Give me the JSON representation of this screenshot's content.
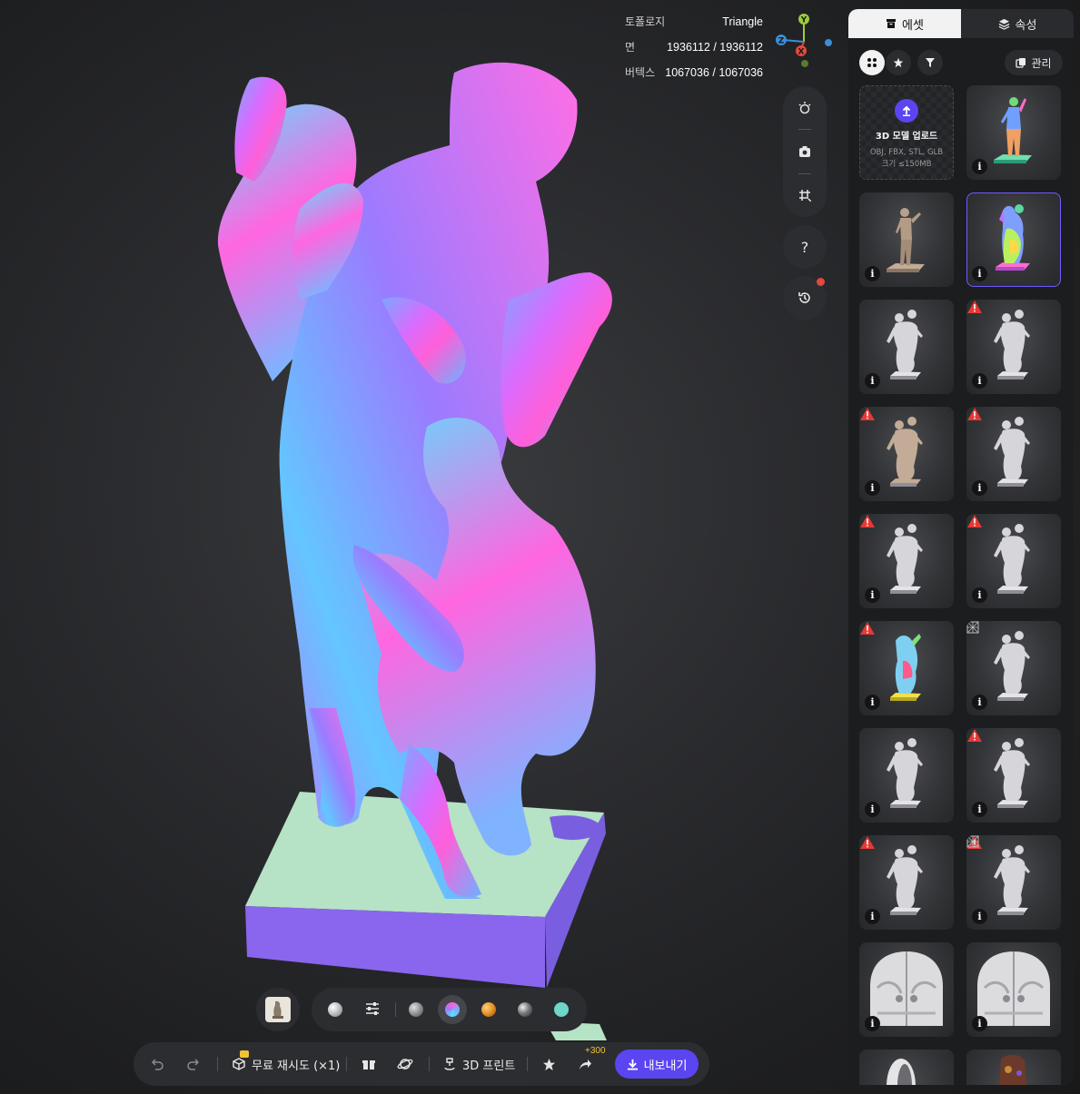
{
  "stats": {
    "topology_label": "토폴로지",
    "topology_value": "Triangle",
    "faces_label": "면",
    "faces_value": "1936112 / 1936112",
    "vertices_label": "버텍스",
    "vertices_value": "1067036 / 1067036"
  },
  "gizmo": {
    "y": "Y",
    "x": "X",
    "z": "Z"
  },
  "colors": {
    "accent": "#5a45f0",
    "panel": "#2c2d30",
    "sidebar": "#1c1d1f",
    "warning": "#e53935",
    "axis_y": "#9ccc3c",
    "axis_x": "#e5483f",
    "axis_z": "#3a8fd8"
  },
  "sidebar": {
    "tabs": [
      {
        "label": "에셋",
        "icon": "box-icon",
        "active": true
      },
      {
        "label": "속성",
        "icon": "layers-icon",
        "active": false
      }
    ],
    "manage_label": "관리",
    "upload": {
      "title": "3D 모델 업로드",
      "formats": "OBJ, FBX, STL, GLB",
      "size_limit": "크기 ≤150MB"
    }
  },
  "bottombar": {
    "retry_label": "무료 재시도 (×1)",
    "print_label": "3D 프린트",
    "share_bonus": "+300",
    "export_label": "내보내기"
  },
  "help_label": "?"
}
